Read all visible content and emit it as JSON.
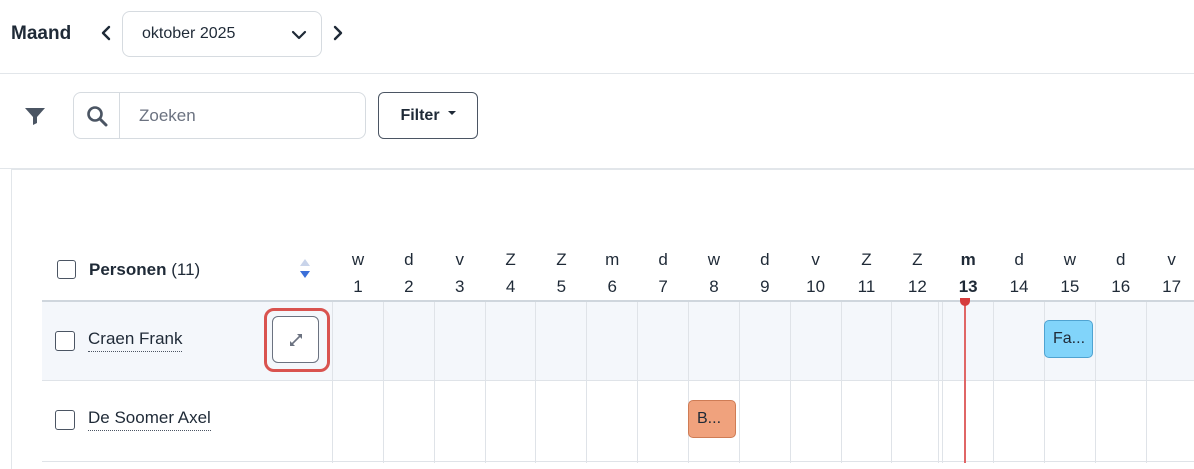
{
  "view": {
    "label": "Maand",
    "selected_month": "oktober 2025"
  },
  "search": {
    "placeholder": "Zoeken"
  },
  "filter": {
    "label": "Filter"
  },
  "table": {
    "header_label": "Personen",
    "header_count": "(11)",
    "days": [
      {
        "letter": "w",
        "num": "1"
      },
      {
        "letter": "d",
        "num": "2"
      },
      {
        "letter": "v",
        "num": "3"
      },
      {
        "letter": "Z",
        "num": "4"
      },
      {
        "letter": "Z",
        "num": "5"
      },
      {
        "letter": "m",
        "num": "6"
      },
      {
        "letter": "d",
        "num": "7"
      },
      {
        "letter": "w",
        "num": "8"
      },
      {
        "letter": "d",
        "num": "9"
      },
      {
        "letter": "v",
        "num": "10"
      },
      {
        "letter": "Z",
        "num": "11"
      },
      {
        "letter": "Z",
        "num": "12"
      },
      {
        "letter": "m",
        "num": "13",
        "today": true
      },
      {
        "letter": "d",
        "num": "14"
      },
      {
        "letter": "w",
        "num": "15"
      },
      {
        "letter": "d",
        "num": "16"
      },
      {
        "letter": "v",
        "num": "17"
      }
    ],
    "rows": [
      {
        "name": "Craen Frank",
        "event": {
          "label": "Fa...",
          "day": "15",
          "color": "#81d4fa"
        }
      },
      {
        "name": "De Soomer Axel",
        "event": {
          "label": "B...",
          "day": "8",
          "color": "#f0a27d"
        }
      }
    ]
  },
  "colors": {
    "today_line": "#e06666",
    "highlight": "#d9534f"
  }
}
